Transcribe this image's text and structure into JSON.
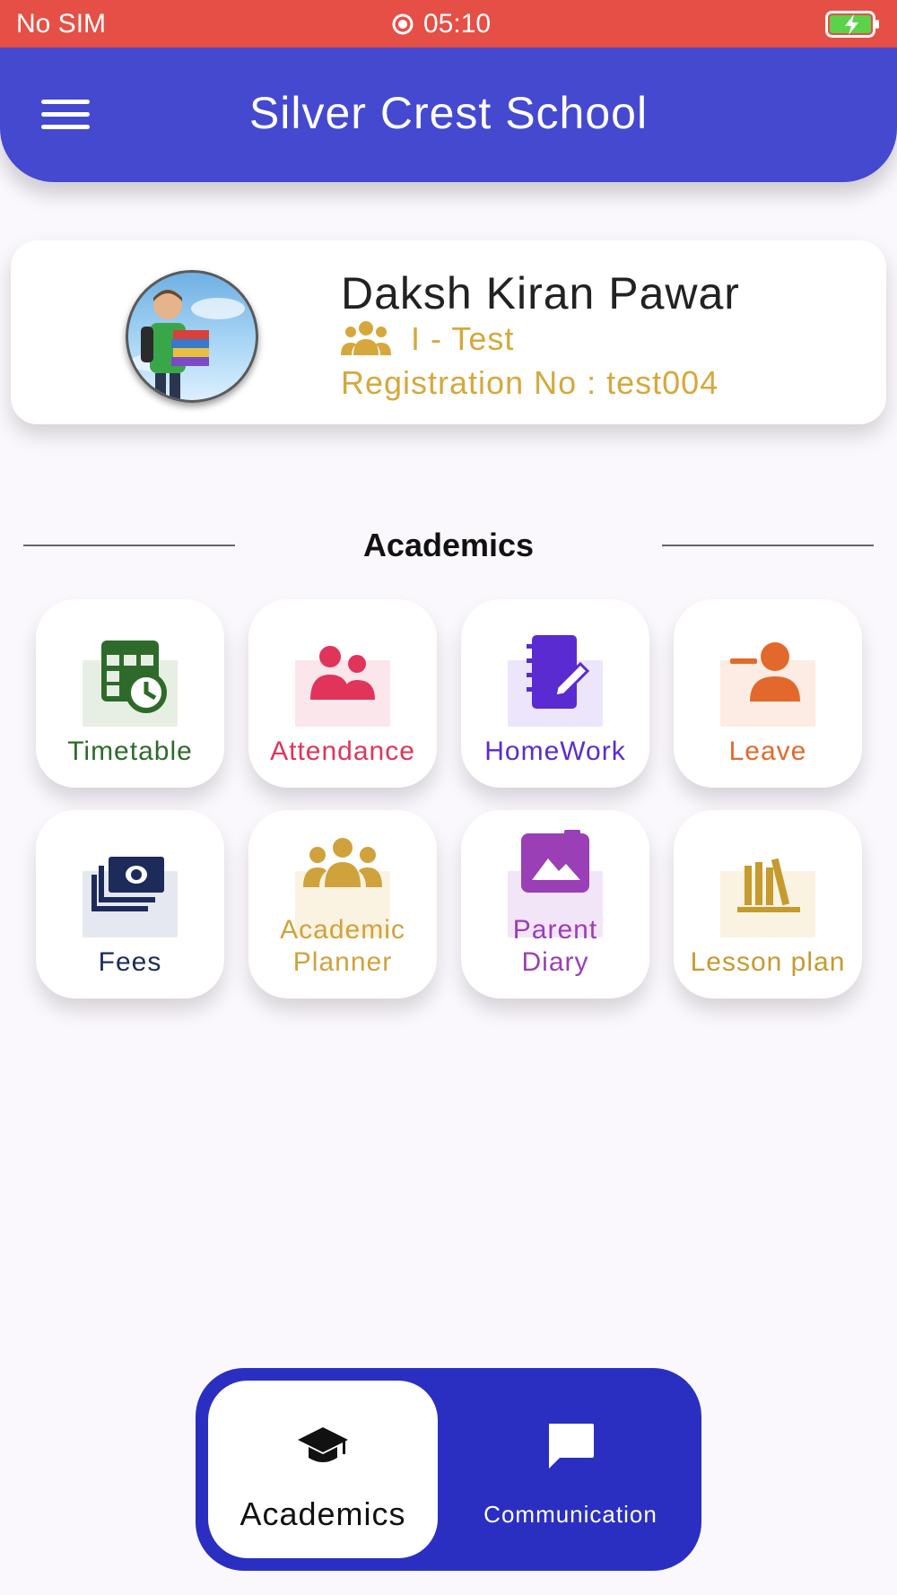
{
  "status_bar": {
    "carrier": "No SIM",
    "time": "05:10",
    "battery_icon": "battery-charging-icon"
  },
  "app_bar": {
    "title": "Silver Crest School",
    "menu_icon": "hamburger-menu-icon",
    "color": "#4449d0"
  },
  "profile": {
    "name": "Daksh Kiran Pawar",
    "class": "I - Test",
    "registration": "Registration No : test004",
    "class_icon": "group-icon",
    "accent": "#d6a83c"
  },
  "section": {
    "title": "Academics"
  },
  "tiles": [
    {
      "label": "Timetable",
      "icon": "timetable-clock-icon",
      "color": "#2e6b2a",
      "bg": "#e7efe4"
    },
    {
      "label": "Attendance",
      "icon": "people-icon",
      "color": "#e0345a",
      "bg": "#fbe6ec"
    },
    {
      "label": "HomeWork",
      "icon": "notebook-pencil-icon",
      "color": "#5a2bd0",
      "bg": "#ece5fb"
    },
    {
      "label": "Leave",
      "icon": "person-minus-icon",
      "color": "#e2692b",
      "bg": "#fcece3"
    },
    {
      "label": "Fees",
      "icon": "money-stack-icon",
      "color": "#1c2b5a",
      "bg": "#e5e8f0"
    },
    {
      "label_line1": "Academic",
      "label_line2": "Planner",
      "icon": "group-icon",
      "color": "#d0a23c",
      "bg": "#fbf3e2"
    },
    {
      "label_line1": "Parent",
      "label_line2": "Diary",
      "icon": "photo-album-icon",
      "color": "#9a3fb5",
      "bg": "#f3e5f8"
    },
    {
      "label": "Lesson plan",
      "icon": "books-icon",
      "color": "#c59a2f",
      "bg": "#faf3e2"
    }
  ],
  "bottom_nav": {
    "items": [
      {
        "label": "Academics",
        "icon": "graduation-cap-icon",
        "active": true
      },
      {
        "label": "Communication",
        "icon": "chat-bubble-icon",
        "active": false
      }
    ],
    "color": "#2a2fc2"
  }
}
